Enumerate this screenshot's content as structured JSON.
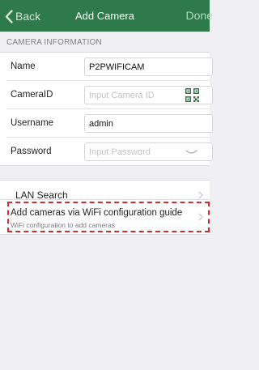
{
  "navbar": {
    "back_label": "Back",
    "title": "Add Camera",
    "done_label": "Done"
  },
  "section": {
    "header": "CAMERA INFORMATION"
  },
  "form": {
    "name": {
      "label": "Name",
      "value": "P2PWIFICAM",
      "placeholder": ""
    },
    "camera_id": {
      "label": "CameraID",
      "value": "",
      "placeholder": "Input Camera ID"
    },
    "username": {
      "label": "Username",
      "value": "admin",
      "placeholder": ""
    },
    "password": {
      "label": "Password",
      "value": "",
      "placeholder": "Input Password"
    }
  },
  "lan_search": {
    "label": "LAN Search"
  },
  "wifi_guide": {
    "title": "Add cameras via WiFi configuration guide",
    "subtitle": "WiFi configuration to add cameras"
  },
  "colors": {
    "navbar_bg": "#2f7a4a",
    "highlight_dash": "#d42a2a",
    "background": "#f0eff4"
  },
  "icons": {
    "back": "chevron-left-icon",
    "camera_id": "qr-code-icon",
    "password": "eye-closed-icon",
    "disclosure": "chevron-right-icon"
  }
}
